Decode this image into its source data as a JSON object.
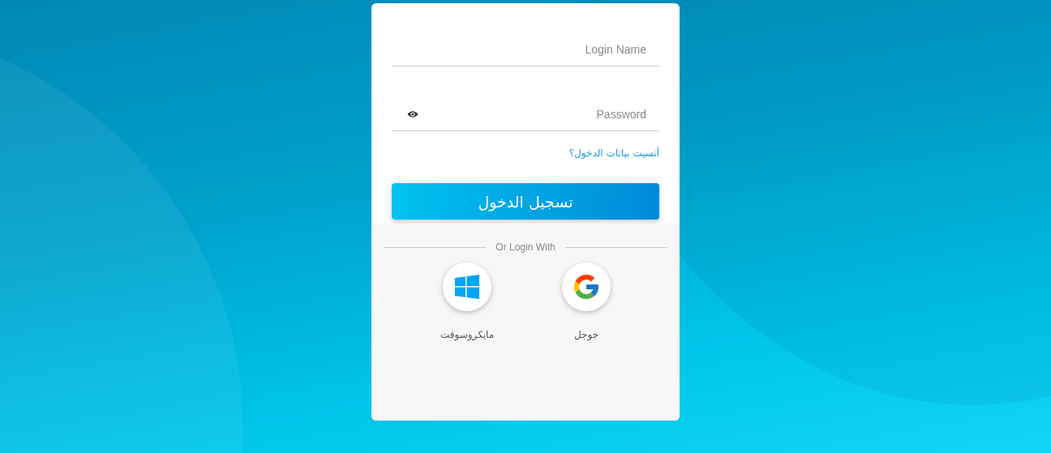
{
  "login_form": {
    "fields": [
      {
        "kind": "text",
        "placeholder": "Login Name"
      },
      {
        "kind": "password",
        "placeholder": "Password"
      }
    ],
    "forgot_link": "أنسيت بيانات الدخول؟",
    "submit_button": "تسجيل الدخول"
  },
  "social": {
    "divider_label": "Or Login With",
    "providers": [
      {
        "kind": "google",
        "label": "جوجل"
      },
      {
        "kind": "microsoft",
        "label": "مايكروسوفت"
      }
    ]
  }
}
